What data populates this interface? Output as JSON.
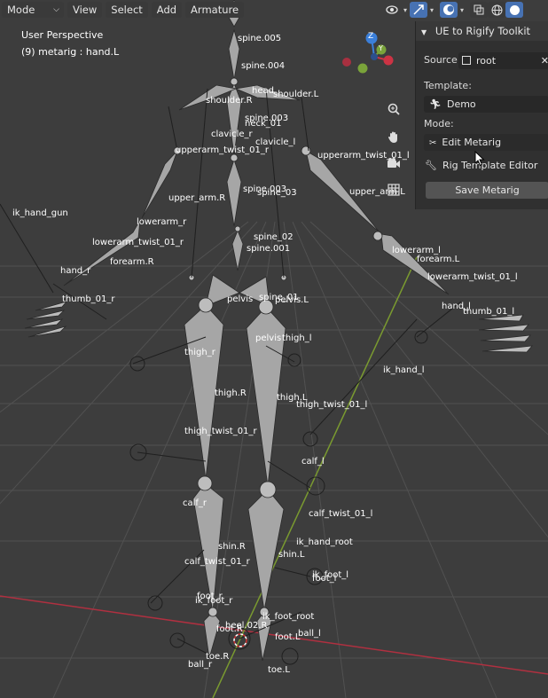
{
  "header": {
    "mode_label": "Mode",
    "menus": [
      "View",
      "Select",
      "Add",
      "Armature"
    ]
  },
  "overlay": {
    "view_name": "User Perspective",
    "active_object": "(9) metarig : hand.L"
  },
  "gizmo": {
    "axis_z": "Z",
    "axis_y": "Y"
  },
  "nav_icons": [
    "zoom-icon",
    "pan-hand-icon",
    "camera-icon",
    "grid-icon"
  ],
  "panel": {
    "title": "UE to Rigify Toolkit",
    "source_label": "Source:",
    "source_value": "root",
    "template_label": "Template:",
    "template_value": "Demo",
    "mode_label": "Mode:",
    "mode_value": "Edit Metarig",
    "rig_template_editor": "Rig Template Editor",
    "save_button": "Save Metarig"
  },
  "bone_labels": [
    "spine.005",
    "spine.004",
    "head",
    "shoulder.L",
    "shoulder.R",
    "neck_01",
    "spine.003",
    "clavicle_r",
    "clavicle_l",
    "upperarm_twist_01_r",
    "upperarm_twist_01_l",
    "spine.003",
    "spine_03",
    "upper_arm.R",
    "upper_arm.L",
    "ik_hand_gun",
    "lowerarm_r",
    "spine_02",
    "spine.001",
    "lowerarm_l",
    "lowerarm_twist_01_r",
    "forearm.R",
    "forearm.L",
    "hand_r",
    "lowerarm_twist_01_l",
    "thumb_01_r",
    "hand_l",
    "thumb_01_l",
    "pelvis",
    "spine_01",
    "pelvis.L",
    "pelvis",
    "thigh_l",
    "thigh_r",
    "ik_hand_l",
    "thigh.R",
    "thigh.L",
    "thigh_twist_01_l",
    "thigh_twist_01_r",
    "calf_l",
    "calf_r",
    "calf_twist_01_l",
    "ik_hand_root",
    "shin.R",
    "shin.L",
    "calf_twist_01_r",
    "ik_foot_l",
    "foot_l",
    "foot_r",
    "ik_foot_r",
    "ik_foot_root",
    "heel.02.R",
    "ball_l",
    "foot.R",
    "foot.L",
    "toe.R",
    "ball_r",
    "toe.L"
  ],
  "colors": {
    "accent": "#4772b3",
    "axis_x": "#cc3344",
    "axis_y": "#7aa33a",
    "axis_z": "#3b7fd9",
    "bone": "#a6a6a6"
  }
}
